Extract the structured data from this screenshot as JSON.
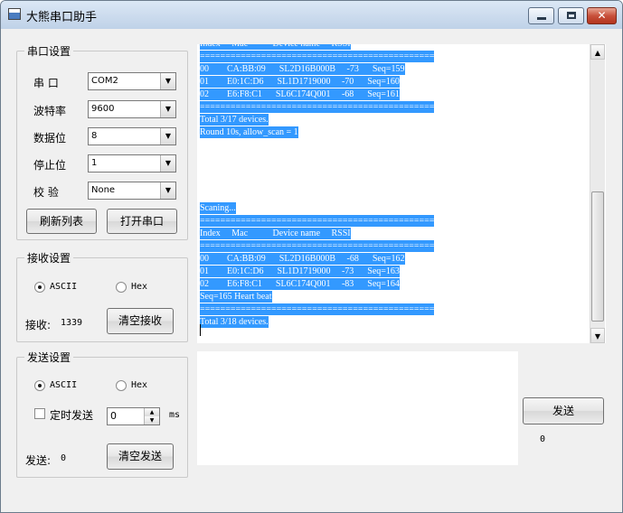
{
  "window": {
    "title": "大熊串口助手"
  },
  "serial": {
    "group_title": "串口设置",
    "fields": [
      {
        "label": "串  口",
        "value": "COM2"
      },
      {
        "label": "波特率",
        "value": "9600"
      },
      {
        "label": "数据位",
        "value": "8"
      },
      {
        "label": "停止位",
        "value": "1"
      },
      {
        "label": "校  验",
        "value": "None"
      }
    ],
    "refresh_button": "刷新列表",
    "open_button": "打开串口"
  },
  "receive": {
    "group_title": "接收设置",
    "ascii_label": "ASCII",
    "hex_label": "Hex",
    "selected_mode": "ASCII",
    "count_label": "接收: ",
    "count_value": "1339",
    "clear_button": "清空接收"
  },
  "send": {
    "group_title": "发送设置",
    "ascii_label": "ASCII",
    "hex_label": "Hex",
    "selected_mode": "ASCII",
    "timer_label": "定时发送",
    "timer_checked": false,
    "interval_value": "0",
    "interval_unit": "ms",
    "count_label": "发送: ",
    "count_value": "0",
    "clear_button": "清空发送",
    "send_button": "发送",
    "send_count": "0",
    "input_value": ""
  },
  "console": {
    "lines": [
      "Index     Mac           Device name     RSSI",
      "==============================================",
      "00        CA:BB:09      SL2D16B000B     -73      Seq=159",
      "01        E0:1C:D6      SL1D1719000     -70      Seq=160",
      "02        E6:F8:C1      SL6C174Q001     -68      Seq=161",
      "==============================================",
      "Total 3/17 devices.",
      "Round 10s, allow_scan = 1",
      "",
      "",
      "",
      "",
      "",
      "Scaning...",
      "==============================================",
      "Index     Mac           Device name     RSSI",
      "==============================================",
      "00        CA:BB:09      SL2D16B000B     -68      Seq=162",
      "01        E0:1C:D6      SL1D1719000     -73      Seq=163",
      "02        E6:F8:C1      SL6C174Q001     -83      Seq=164",
      "Seq=165 Heart beat",
      "==============================================",
      "Total 3/18 devices."
    ]
  },
  "colors": {
    "selection": "#3399ff"
  }
}
